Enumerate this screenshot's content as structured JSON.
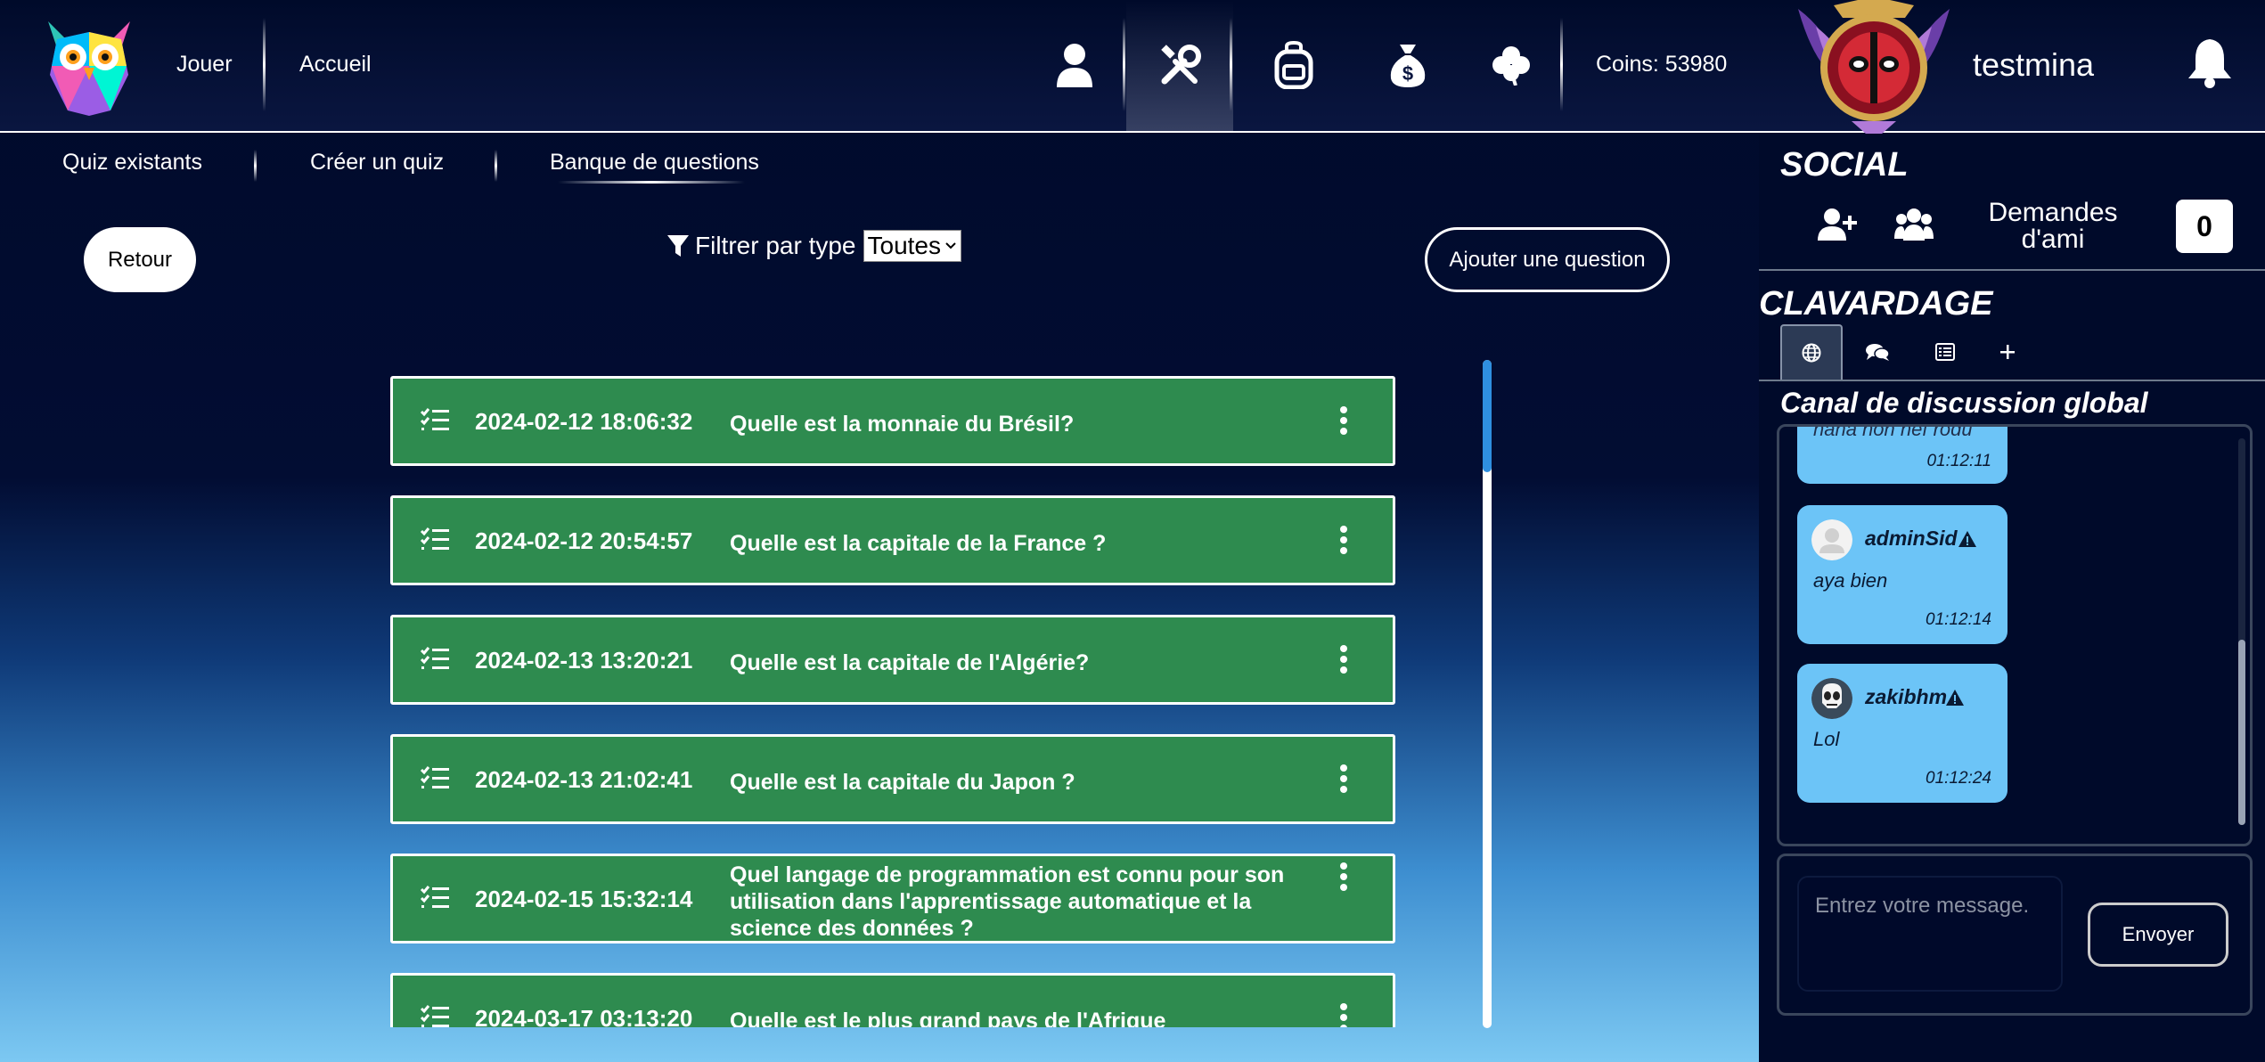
{
  "nav": {
    "play_label": "Jouer",
    "home_label": "Accueil",
    "coins_label": "Coins: 53980",
    "username": "testmina"
  },
  "subtabs": {
    "existing": "Quiz existants",
    "create": "Créer un quiz",
    "bank": "Banque de questions"
  },
  "controls": {
    "back_label": "Retour",
    "filter_label": "Filtrer par type",
    "filter_value": "Toutes",
    "add_label": "Ajouter une question"
  },
  "questions": [
    {
      "date": "2024-02-12 18:06:32",
      "text": "Quelle est la monnaie du Brésil?"
    },
    {
      "date": "2024-02-12 20:54:57",
      "text": "Quelle est la capitale de la France ?"
    },
    {
      "date": "2024-02-13 13:20:21",
      "text": "Quelle est la capitale de l'Algérie?"
    },
    {
      "date": "2024-02-13 21:02:41",
      "text": "Quelle est la capitale du Japon ?"
    },
    {
      "date": "2024-02-15 15:32:14",
      "text": "Quel langage de programmation est connu pour son utilisation dans l'apprentissage automatique et la science des données ?"
    },
    {
      "date": "2024-03-17 03:13:20",
      "text": "Quelle est le plus grand pays de l'Afrique"
    }
  ],
  "social": {
    "title": "SOCIAL",
    "friend_requests_label": "Demandes d'ami",
    "friend_requests_count": "0"
  },
  "chat": {
    "title": "CLAVARDAGE",
    "channel_title": "Canal de discussion global",
    "messages": [
      {
        "user": "",
        "text": "haha non nef rodu",
        "time": "01:12:11"
      },
      {
        "user": "adminSid",
        "text": "aya bien",
        "time": "01:12:14"
      },
      {
        "user": "zakibhm",
        "text": "Lol",
        "time": "01:12:24"
      }
    ],
    "input_placeholder": "Entrez votre message.",
    "send_label": "Envoyer"
  }
}
